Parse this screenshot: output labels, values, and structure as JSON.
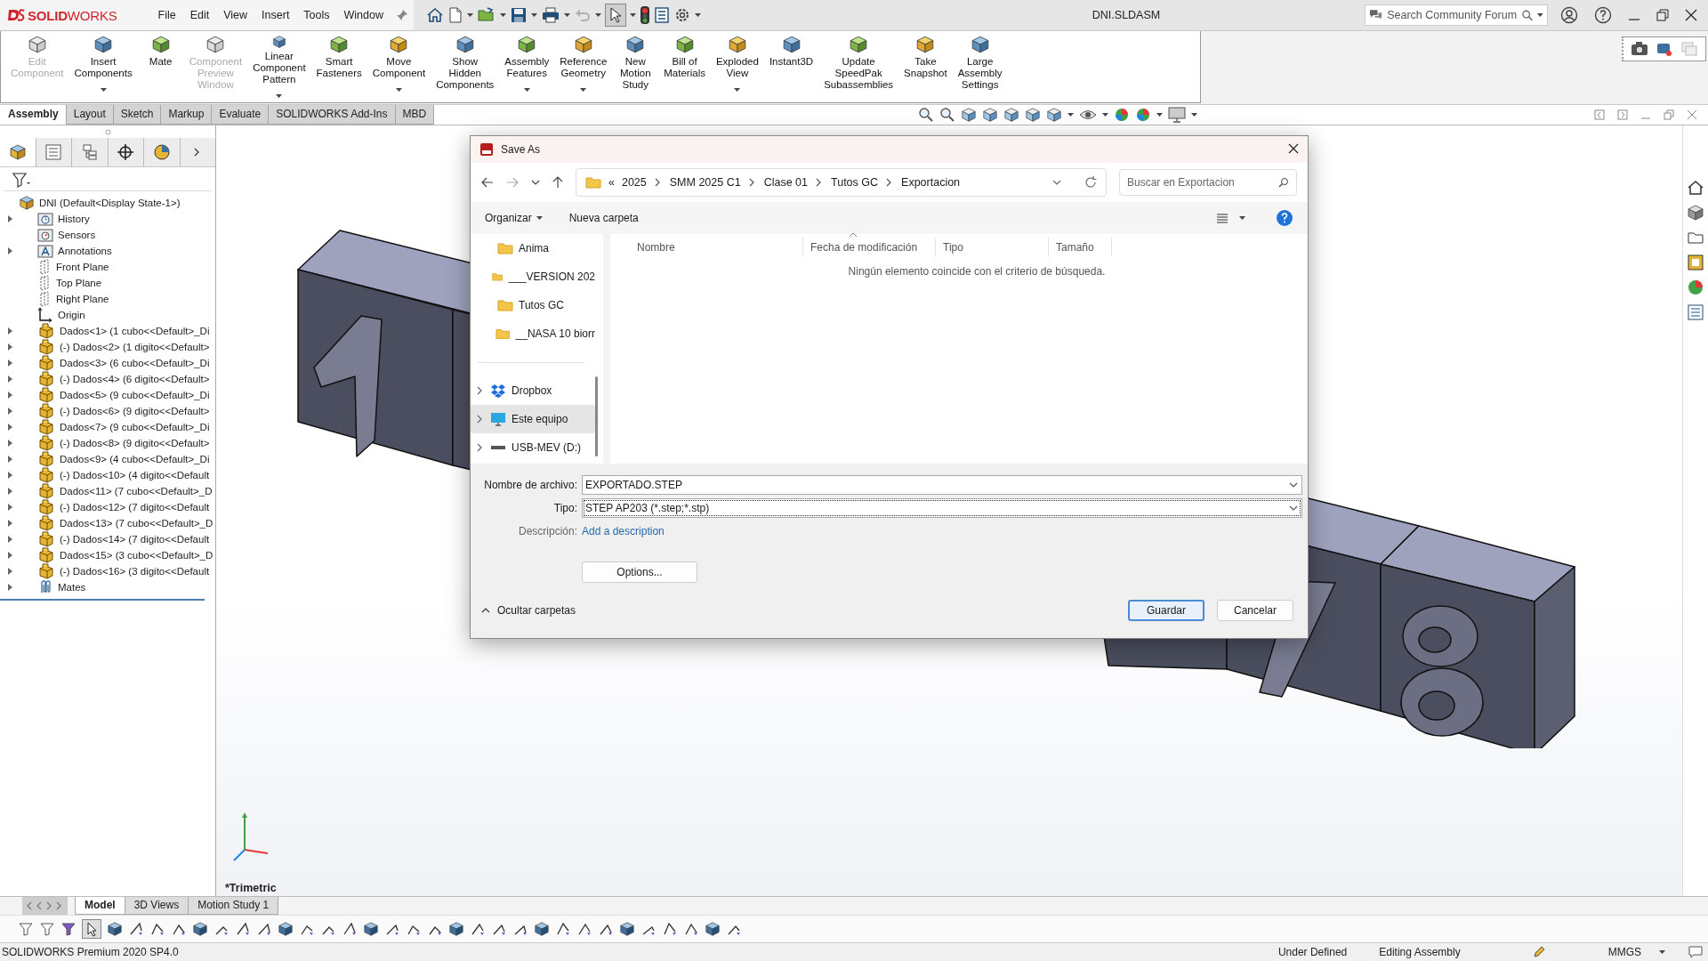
{
  "titlebar": {
    "logo": "**SOLID**WORKS",
    "menu": [
      "File",
      "Edit",
      "View",
      "Insert",
      "Tools",
      "Window"
    ],
    "document_title": "DNI.SLDASM",
    "search": {
      "placeholder": "Search Community Forum"
    }
  },
  "ribbon": [
    {
      "label": "Edit Component",
      "disabled": true,
      "dropdown": false
    },
    {
      "label": "Insert Components",
      "disabled": false,
      "dropdown": true
    },
    {
      "label": "Mate",
      "disabled": false,
      "dropdown": false
    },
    {
      "label": "Component Preview Window",
      "disabled": true,
      "dropdown": false
    },
    {
      "label": "Linear Component Pattern",
      "disabled": false,
      "dropdown": true
    },
    {
      "label": "Smart Fasteners",
      "disabled": false,
      "dropdown": false
    },
    {
      "label": "Move Component",
      "disabled": false,
      "dropdown": true
    },
    {
      "label": "Show Hidden Components",
      "disabled": false,
      "dropdown": false
    },
    {
      "label": "Assembly Features",
      "disabled": false,
      "dropdown": true
    },
    {
      "label": "Reference Geometry",
      "disabled": false,
      "dropdown": true
    },
    {
      "label": "New Motion Study",
      "disabled": false,
      "dropdown": false
    },
    {
      "label": "Bill of Materials",
      "disabled": false,
      "dropdown": false
    },
    {
      "label": "Exploded View",
      "disabled": false,
      "dropdown": true
    },
    {
      "label": "Instant3D",
      "disabled": false,
      "dropdown": false
    },
    {
      "label": "Update SpeedPak Subassemblies",
      "disabled": false,
      "dropdown": false
    },
    {
      "label": "Take Snapshot",
      "disabled": false,
      "dropdown": false
    },
    {
      "label": "Large Assembly Settings",
      "disabled": false,
      "dropdown": false
    }
  ],
  "command_tabs": [
    {
      "label": "Assembly",
      "selected": true
    },
    {
      "label": "Layout",
      "selected": false
    },
    {
      "label": "Sketch",
      "selected": false
    },
    {
      "label": "Markup",
      "selected": false
    },
    {
      "label": "Evaluate",
      "selected": false
    },
    {
      "label": "SOLIDWORKS Add-Ins",
      "selected": false
    },
    {
      "label": "MBD",
      "selected": false
    }
  ],
  "feature_tree": {
    "root": "DNI  (Default<Display State-1>)",
    "items": [
      {
        "kind": "history",
        "label": "History",
        "expandable": true
      },
      {
        "kind": "sensors",
        "label": "Sensors",
        "expandable": false
      },
      {
        "kind": "annotations",
        "label": "Annotations",
        "expandable": true
      },
      {
        "kind": "plane",
        "label": "Front Plane",
        "expandable": false
      },
      {
        "kind": "plane",
        "label": "Top Plane",
        "expandable": false
      },
      {
        "kind": "plane",
        "label": "Right Plane",
        "expandable": false
      },
      {
        "kind": "origin",
        "label": "Origin",
        "expandable": false
      },
      {
        "kind": "part",
        "label": "Dados<1> (1 cubo<<Default>_Di",
        "expandable": true
      },
      {
        "kind": "part",
        "label": "(-) Dados<2> (1 digito<<Default>",
        "expandable": true
      },
      {
        "kind": "part",
        "label": "Dados<3> (6 cubo<<Default>_Di",
        "expandable": true
      },
      {
        "kind": "part",
        "label": "(-) Dados<4> (6 digito<<Default>",
        "expandable": true
      },
      {
        "kind": "part",
        "label": "Dados<5> (9 cubo<<Default>_Di",
        "expandable": true
      },
      {
        "kind": "part",
        "label": "(-) Dados<6> (9 digito<<Default>",
        "expandable": true
      },
      {
        "kind": "part",
        "label": "Dados<7> (9 cubo<<Default>_Di",
        "expandable": true
      },
      {
        "kind": "part",
        "label": "(-) Dados<8> (9 digito<<Default>",
        "expandable": true
      },
      {
        "kind": "part",
        "label": "Dados<9> (4 cubo<<Default>_Di",
        "expandable": true
      },
      {
        "kind": "part",
        "label": "(-) Dados<10> (4 digito<<Default",
        "expandable": true
      },
      {
        "kind": "part",
        "label": "Dados<11> (7 cubo<<Default>_D",
        "expandable": true
      },
      {
        "kind": "part",
        "label": "(-) Dados<12> (7 digito<<Default",
        "expandable": true
      },
      {
        "kind": "part",
        "label": "Dados<13> (7 cubo<<Default>_D",
        "expandable": true
      },
      {
        "kind": "part",
        "label": "(-) Dados<14> (7 digito<<Default",
        "expandable": true
      },
      {
        "kind": "part",
        "label": "Dados<15> (3 cubo<<Default>_D",
        "expandable": true
      },
      {
        "kind": "part",
        "label": "(-) Dados<16> (3 digito<<Default",
        "expandable": true
      },
      {
        "kind": "mates",
        "label": "Mates",
        "expandable": true
      }
    ]
  },
  "viewport": {
    "view_name": "*Trimetric"
  },
  "save_dialog": {
    "title": "Save As",
    "path": [
      "2025",
      "SMM 2025 C1",
      "Clase 01",
      "Tutos GC",
      "Exportacion"
    ],
    "path_overflow": "«",
    "search": {
      "placeholder": "Buscar en Exportacion"
    },
    "organize": "Organizar",
    "new_folder": "Nueva carpeta",
    "nav": [
      {
        "kind": "folder",
        "label": "Anima",
        "expandable": false,
        "selected": false
      },
      {
        "kind": "folder",
        "label": "___VERSION 202",
        "expandable": false,
        "selected": false
      },
      {
        "kind": "folder",
        "label": "Tutos GC",
        "expandable": false,
        "selected": false
      },
      {
        "kind": "folder",
        "label": "__NASA 10 biorr",
        "expandable": false,
        "selected": false
      },
      {
        "kind": "dropbox",
        "label": "Dropbox",
        "expandable": true,
        "selected": false
      },
      {
        "kind": "computer",
        "label": "Este equipo",
        "expandable": true,
        "selected": true
      },
      {
        "kind": "drive",
        "label": "USB-MEV (D:)",
        "expandable": true,
        "selected": false
      }
    ],
    "columns": [
      "Nombre",
      "Fecha de modificación",
      "Tipo",
      "Tamaño"
    ],
    "empty_message": "Ningún elemento coincide con el criterio de búsqueda.",
    "filename_label": "Nombre de archivo:",
    "filename": "EXPORTADO.STEP",
    "type_label": "Tipo:",
    "type": "STEP AP203 (*.step;*.stp)",
    "description_label": "Descripción:",
    "description_link": "Add a description",
    "options_button": "Options...",
    "hide_folders": "Ocultar carpetas",
    "save_button": "Guardar",
    "cancel_button": "Cancelar"
  },
  "bottom_tabs": [
    {
      "label": "Model",
      "selected": true
    },
    {
      "label": "3D Views",
      "selected": false
    },
    {
      "label": "Motion Study 1",
      "selected": false
    }
  ],
  "status_bar": {
    "product": "SOLIDWORKS Premium 2020 SP4.0",
    "state": "Under Defined",
    "mode": "Editing Assembly",
    "units": "MMGS"
  }
}
